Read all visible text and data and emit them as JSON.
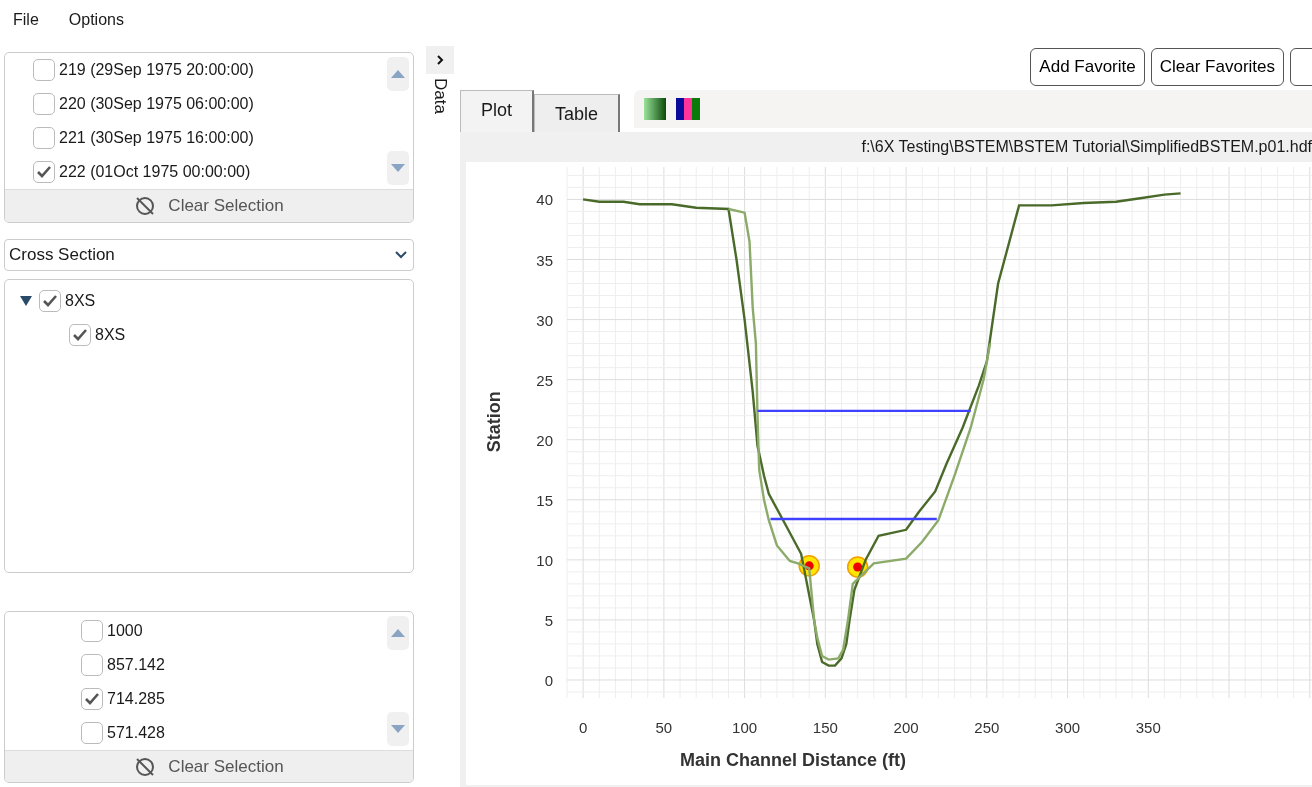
{
  "menu": [
    {
      "label": "File"
    },
    {
      "label": "Options"
    }
  ],
  "time_list": {
    "items": [
      {
        "label": "219 (29Sep 1975 20:00:00)",
        "checked": false
      },
      {
        "label": "220 (30Sep 1975 06:00:00)",
        "checked": false
      },
      {
        "label": "221 (30Sep 1975 16:00:00)",
        "checked": false
      },
      {
        "label": "222 (01Oct 1975 00:00:00)",
        "checked": true
      }
    ],
    "clear_button": "Clear Selection"
  },
  "dropdown": {
    "value": "Cross Section"
  },
  "tree": [
    {
      "label": "8XS",
      "checked": true,
      "expanded": true,
      "children": [
        {
          "label": "8XS",
          "checked": true
        }
      ]
    }
  ],
  "station_list": {
    "items": [
      {
        "label": "1000",
        "checked": false
      },
      {
        "label": "857.142",
        "checked": false
      },
      {
        "label": "714.285",
        "checked": true
      },
      {
        "label": "571.428",
        "checked": false
      }
    ],
    "clear_button": "Clear Selection"
  },
  "side_tab": {
    "label": "Data"
  },
  "buttons": [
    "Add Favorite",
    "Clear Favorites"
  ],
  "tabs": [
    {
      "label": "Plot",
      "selected": true
    },
    {
      "label": "Table",
      "selected": false
    }
  ],
  "file_path": "f:\\6X Testing\\BSTEM\\BSTEM Tutorial\\SimplifiedBSTEM.p01.hdf",
  "chart_data": {
    "type": "line",
    "grid": true,
    "xlabel": "Main Channel Distance (ft)",
    "ylabel": "Station",
    "xlim": [
      -10,
      452
    ],
    "ylim": [
      -1.5,
      42.7
    ],
    "xticks": [
      0,
      50,
      100,
      150,
      200,
      250,
      300,
      350
    ],
    "yticks": [
      0,
      5,
      10,
      15,
      20,
      25,
      30,
      35,
      40
    ],
    "series": [
      {
        "color": "#4a6a2a",
        "x": [
          0,
          10,
          25,
          35,
          55,
          70,
          90,
          95,
          100,
          105,
          108,
          112,
          115,
          125,
          135,
          143,
          145,
          148,
          152,
          156,
          160,
          163,
          165,
          168,
          175,
          183,
          200,
          208,
          218,
          225,
          235,
          245,
          250,
          257,
          270,
          290,
          310,
          330,
          345,
          360,
          370
        ],
        "values": [
          40,
          39.8,
          39.8,
          39.6,
          39.6,
          39.3,
          39.2,
          35,
          30,
          24,
          19.5,
          17,
          15.5,
          13,
          10.5,
          5,
          3,
          1.5,
          1.2,
          1.2,
          1.8,
          3,
          5,
          7.5,
          10,
          12,
          12.5,
          14,
          15.7,
          18,
          21,
          24.5,
          26.5,
          33,
          39.5,
          39.5,
          39.7,
          39.8,
          40.1,
          40.4,
          40.5
        ]
      },
      {
        "color": "#8cab6a",
        "x": [
          90,
          100,
          103,
          105,
          107,
          108,
          109,
          112,
          115,
          120,
          128,
          133,
          140,
          143,
          145,
          148,
          152,
          158,
          161,
          164,
          167,
          180,
          200,
          210,
          220,
          230,
          240,
          248,
          252
        ],
        "values": [
          39.2,
          38.9,
          36.5,
          31,
          28,
          22,
          17.5,
          15,
          13.3,
          11.2,
          9.9,
          9.7,
          9.3,
          5,
          3.5,
          2,
          1.7,
          1.8,
          2.5,
          5,
          8,
          9.7,
          10.1,
          11.5,
          13.3,
          17,
          21,
          25,
          28
        ]
      },
      {
        "color": "#4040ff",
        "x": [
          108,
          240
        ],
        "values": [
          22.4,
          22.4
        ]
      },
      {
        "color": "#4040ff",
        "x": [
          116,
          219
        ],
        "values": [
          13.4,
          13.4
        ]
      },
      {
        "type": "scatter",
        "color": "#ffe600",
        "x": [
          140,
          170
        ],
        "values": [
          9.5,
          9.4
        ]
      }
    ]
  }
}
